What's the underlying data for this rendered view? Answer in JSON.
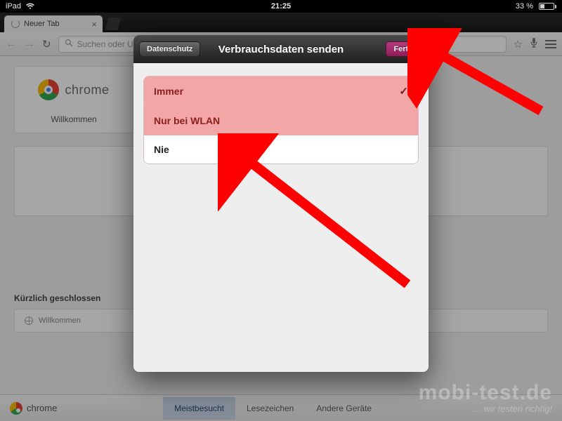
{
  "status": {
    "device": "iPad",
    "time": "21:25",
    "battery_pct": "33 %",
    "wifi_icon": "wifi",
    "battery_icon": "battery"
  },
  "tabstrip": {
    "tab_title": "Neuer Tab"
  },
  "toolbar": {
    "back_icon": "arrow-left",
    "forward_icon": "arrow-right",
    "reload_icon": "reload",
    "search_icon": "magnifier",
    "omnibox_placeholder": "Suchen oder URL eingeben",
    "star_icon": "star",
    "mic_icon": "microphone",
    "menu_icon": "menu"
  },
  "page": {
    "chrome_word": "chrome",
    "welcome_label": "Willkommen",
    "recent_section": "Kürzlich geschlossen",
    "recent_item": "Willkommen"
  },
  "bottombar": {
    "brand": "chrome",
    "tabs": [
      {
        "label": "Meistbesucht",
        "active": true
      },
      {
        "label": "Lesezeichen",
        "active": false
      },
      {
        "label": "Andere Geräte",
        "active": false
      }
    ]
  },
  "modal": {
    "back_label": "Datenschutz",
    "title": "Verbrauchsdaten senden",
    "done_label": "Fertig",
    "options": [
      {
        "label": "Immer",
        "highlighted": true,
        "checked": true
      },
      {
        "label": "Nur bei WLAN",
        "highlighted": true,
        "checked": false
      },
      {
        "label": "Nie",
        "highlighted": false,
        "checked": false
      }
    ]
  },
  "watermark": {
    "line1": "mobi-test.de",
    "line2": "... wir testen richtig!"
  },
  "annotations": {
    "arrow_to_done": "arrow pointing at Fertig button",
    "arrow_to_nie": "arrow pointing at Nie option"
  }
}
